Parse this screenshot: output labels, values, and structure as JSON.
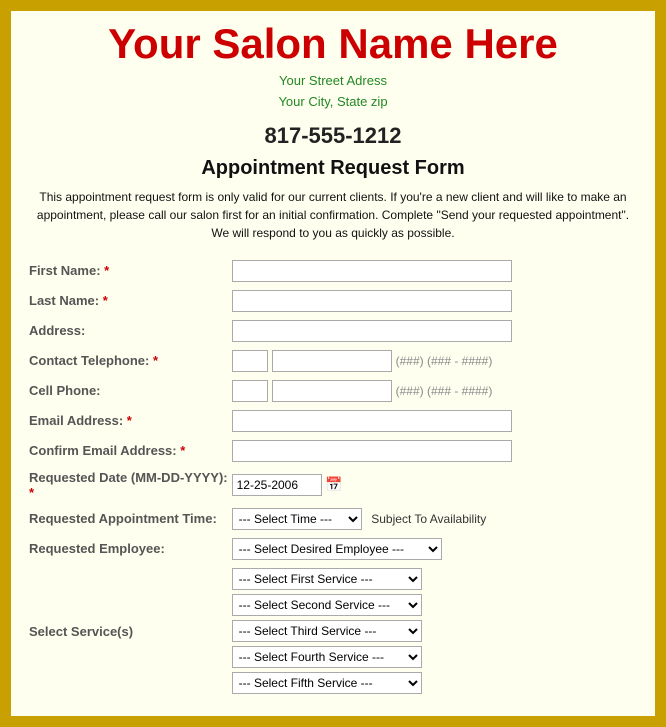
{
  "header": {
    "salon_name": "Your Salon Name Here",
    "address_line1": "Your Street Adress",
    "address_line2": "Your City, State zip",
    "phone": "817-555-1212"
  },
  "form": {
    "title": "Appointment Request Form",
    "description": "This appointment request form is only valid for our current clients. If you're a new client and will like to make an appointment, please call our salon first for an initial confirmation. Complete \"Send your requested appointment\". We will respond to you as quickly as possible.",
    "fields": {
      "first_name_label": "First Name:",
      "last_name_label": "Last Name:",
      "address_label": "Address:",
      "contact_telephone_label": "Contact Telephone:",
      "cell_phone_label": "Cell Phone:",
      "email_label": "Email Address:",
      "confirm_email_label": "Confirm Email Address:",
      "requested_date_label": "Requested Date (MM-DD-YYYY):",
      "requested_time_label": "Requested Appointment Time:",
      "employee_label": "Requested Employee:",
      "service_label": "Select Service(s)",
      "req_marker": "*"
    },
    "defaults": {
      "date_value": "12-25-2006",
      "phone_hint": "(###) (### - ####)"
    },
    "selects": {
      "time_default": "--- Select Time ---",
      "availability_note": "Subject To Availability",
      "employee_default": "--- Select Desired Employee ---",
      "service1_default": "--- Select First Service ---",
      "service2_default": "--- Select Second Service ---",
      "service3_default": "--- Select Third Service ---",
      "service4_default": "--- Select Fourth Service ---",
      "service5_default": "--- Select Fifth Service ---"
    }
  }
}
